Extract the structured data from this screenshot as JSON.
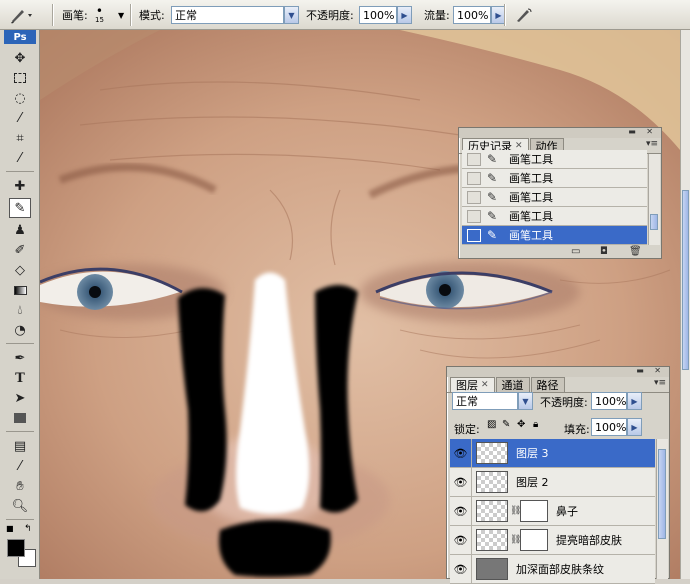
{
  "options_bar": {
    "brush_label": "画笔:",
    "brush_size": "15",
    "mode_label": "模式:",
    "mode_value": "正常",
    "opacity_label": "不透明度:",
    "opacity_value": "100%",
    "flow_label": "流量:",
    "flow_value": "100%"
  },
  "toolbox": {
    "logo": "Ps"
  },
  "history_panel": {
    "tabs": [
      {
        "label": "历史记录",
        "active": true
      },
      {
        "label": "动作",
        "active": false
      }
    ],
    "items": [
      {
        "label": "画笔工具",
        "selected": false
      },
      {
        "label": "画笔工具",
        "selected": false
      },
      {
        "label": "画笔工具",
        "selected": false
      },
      {
        "label": "画笔工具",
        "selected": false
      },
      {
        "label": "画笔工具",
        "selected": true
      }
    ]
  },
  "layers_panel": {
    "tabs": [
      {
        "label": "图层",
        "active": true
      },
      {
        "label": "通道",
        "active": false
      },
      {
        "label": "路径",
        "active": false
      }
    ],
    "blend_mode": "正常",
    "opacity_label": "不透明度:",
    "opacity_value": "100%",
    "lock_label": "锁定:",
    "fill_label": "填充:",
    "fill_value": "100%",
    "layers": [
      {
        "name": "图层 3",
        "selected": true,
        "has_mask": false
      },
      {
        "name": "图层 2",
        "selected": false,
        "has_mask": false
      },
      {
        "name": "鼻子",
        "selected": false,
        "has_mask": true
      },
      {
        "name": "提亮暗部皮肤",
        "selected": false,
        "has_mask": true
      },
      {
        "name": "加深面部皮肤条纹",
        "selected": false,
        "has_mask": false
      }
    ]
  },
  "colors": {
    "selection": "#3a6ac8",
    "foreground": "#000000",
    "background": "#ffffff"
  }
}
